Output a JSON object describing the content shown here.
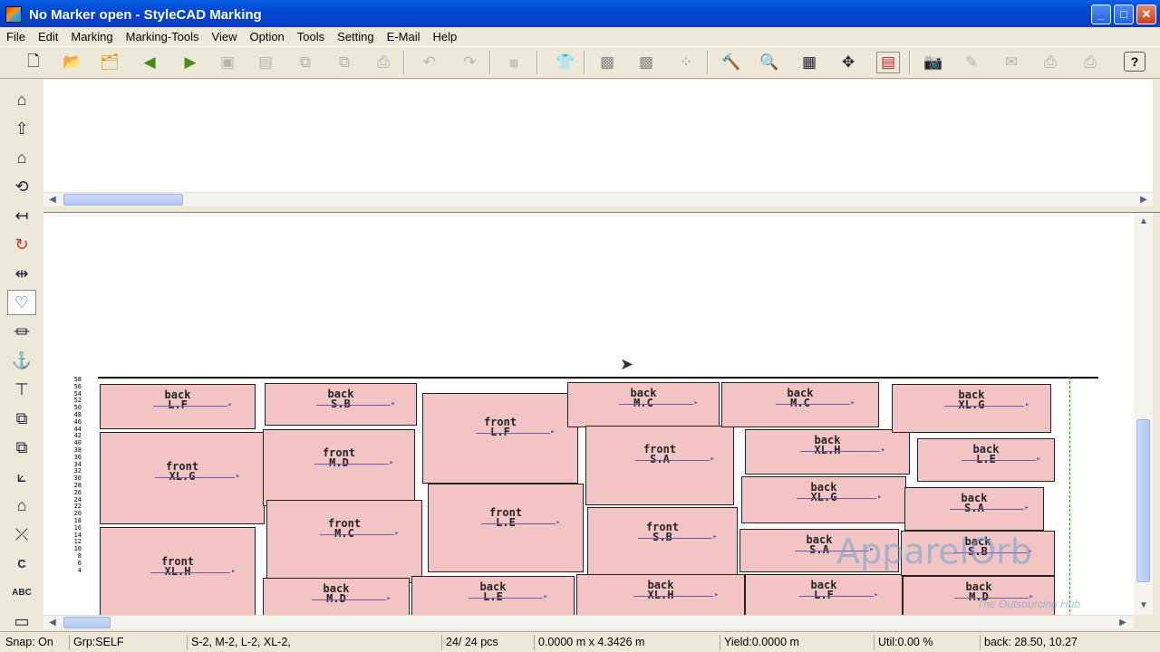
{
  "window": {
    "title": "No Marker open - StyleCAD Marking"
  },
  "menu": [
    "File",
    "Edit",
    "Marking",
    "Marking-Tools",
    "View",
    "Option",
    "Tools",
    "Setting",
    "E-Mail",
    "Help"
  ],
  "toolbar": [
    {
      "icon": "new-file-icon",
      "enabled": true
    },
    {
      "icon": "open-folder-icon",
      "enabled": true
    },
    {
      "icon": "open-multiple-icon",
      "enabled": true
    },
    {
      "icon": "previous-icon",
      "enabled": true
    },
    {
      "icon": "next-icon",
      "enabled": true
    },
    {
      "icon": "save-icon",
      "enabled": false
    },
    {
      "icon": "save-as-icon",
      "enabled": false
    },
    {
      "icon": "copy-icon",
      "enabled": false
    },
    {
      "icon": "paste-icon",
      "enabled": false
    },
    {
      "icon": "print-icon",
      "enabled": false
    },
    {
      "icon": "undo-icon",
      "enabled": false
    },
    {
      "icon": "redo-icon",
      "enabled": false
    },
    {
      "icon": "info-icon",
      "enabled": false
    },
    {
      "icon": "garment-icon",
      "enabled": true
    },
    {
      "icon": "pattern-grid-icon",
      "enabled": true
    },
    {
      "icon": "pattern-grid-2-icon",
      "enabled": true
    },
    {
      "icon": "pattern-dots-icon",
      "enabled": true
    },
    {
      "icon": "hammer-icon",
      "enabled": true
    },
    {
      "icon": "zoom-icon",
      "enabled": true
    },
    {
      "icon": "grid-icon",
      "enabled": true
    },
    {
      "icon": "move-icon",
      "enabled": true
    },
    {
      "icon": "marker-icon",
      "enabled": true
    },
    {
      "icon": "camera-icon",
      "enabled": false
    },
    {
      "icon": "edit-tool-icon",
      "enabled": false
    },
    {
      "icon": "email-icon",
      "enabled": false
    },
    {
      "icon": "plotter-icon",
      "enabled": false
    },
    {
      "icon": "cutter-icon",
      "enabled": false
    },
    {
      "icon": "help-icon",
      "enabled": true
    }
  ],
  "left_tools": [
    "home-icon",
    "up-arrow-icon",
    "layout-icon",
    "rotate-icon",
    "flip-icon",
    "rotate-piece-icon",
    "split-icon",
    "select-piece-icon",
    "hanger-icon",
    "anchor-icon",
    "pin-icon",
    "overlap-icon",
    "group-icon",
    "align-icon",
    "stack-icon",
    "cross-icon",
    "text-icon",
    "abc-icon",
    "ruler-icon"
  ],
  "ruler": [
    "58",
    "56",
    "54",
    "52",
    "50",
    "48",
    "46",
    "44",
    "42",
    "40",
    "38",
    "36",
    "34",
    "32",
    "30",
    "28",
    "26",
    "24",
    "22",
    "20",
    "18",
    "16",
    "14",
    "12",
    "10",
    "8",
    "6",
    "4"
  ],
  "pieces": [
    {
      "name": "back",
      "size": "L.F"
    },
    {
      "name": "back",
      "size": "S.B"
    },
    {
      "name": "front",
      "size": "L.F"
    },
    {
      "name": "back",
      "size": "M.C"
    },
    {
      "name": "back",
      "size": "M.C"
    },
    {
      "name": "back",
      "size": "XL.G"
    },
    {
      "name": "front",
      "size": "XL.G"
    },
    {
      "name": "front",
      "size": "M.D"
    },
    {
      "name": "front",
      "size": "S.A"
    },
    {
      "name": "back",
      "size": "XL.H"
    },
    {
      "name": "back",
      "size": "L.E"
    },
    {
      "name": "front",
      "size": "M.C"
    },
    {
      "name": "front",
      "size": "L.E"
    },
    {
      "name": "front",
      "size": "S.B"
    },
    {
      "name": "back",
      "size": "XL.G"
    },
    {
      "name": "back",
      "size": "S.A"
    },
    {
      "name": "front",
      "size": "XL.H"
    },
    {
      "name": "back",
      "size": "S.A"
    },
    {
      "name": "back",
      "size": "S.B"
    },
    {
      "name": "back",
      "size": "M.D"
    },
    {
      "name": "back",
      "size": "L.E"
    },
    {
      "name": "back",
      "size": "XL.H"
    },
    {
      "name": "back",
      "size": "L.F"
    },
    {
      "name": "back",
      "size": "M.D"
    }
  ],
  "watermark": {
    "brand": "ApparelOrb",
    "tagline": "The Outsourcing Hub"
  },
  "status": {
    "snap": "Snap: On",
    "group": "Grp:SELF",
    "sizes": "S-2, M-2, L-2, XL-2,",
    "pieces": "24/ 24 pcs",
    "dimensions": "0.0000 m x 4.3426 m",
    "yield": "Yield:0.0000 m",
    "util": "Util:0.00 %",
    "selected": "back: 28.50, 10.27"
  }
}
